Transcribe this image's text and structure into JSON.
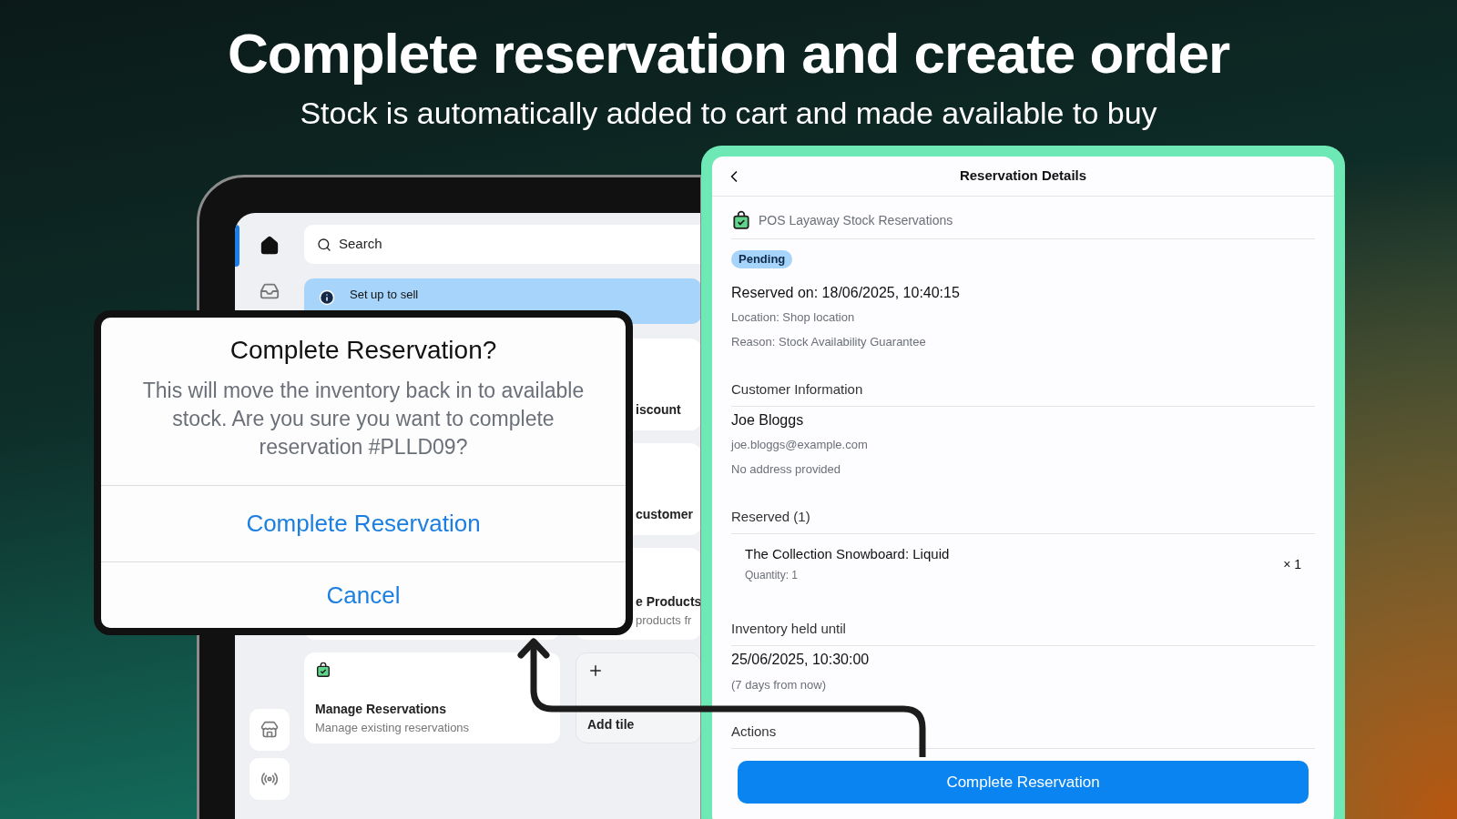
{
  "headline": {
    "title": "Complete reservation and create order",
    "subtitle": "Stock is automatically added to cart and made available to buy"
  },
  "tablet": {
    "sidebar": [
      {
        "kind": "home",
        "selected": true
      },
      {
        "kind": "inbox",
        "selected": false
      },
      {
        "kind": "store",
        "selected": false
      },
      {
        "kind": "broadcast",
        "selected": false
      }
    ],
    "search": {
      "placeholder": "Search"
    },
    "banner": {
      "title": "Set up to sell"
    },
    "tiles": [
      {
        "title": "iscount"
      },
      {
        "title": "customer"
      },
      {
        "title": "e Products",
        "subtitle": "products fr"
      }
    ],
    "bottom_tiles": [
      {
        "kind": "app",
        "title": "Manage Reservations",
        "subtitle": "Manage existing reservations"
      },
      {
        "kind": "add",
        "title": "Add tile"
      }
    ]
  },
  "dialog": {
    "title": "Complete Reservation?",
    "message": "This will move the inventory back in to available stock. Are you sure you want to complete reservation #PLLD09?",
    "actions": [
      {
        "label": "Complete Reservation"
      },
      {
        "label": "Cancel"
      }
    ]
  },
  "details": {
    "title": "Reservation Details",
    "app_name": "POS Layaway Stock Reservations",
    "status": "Pending",
    "reserved_on": "Reserved on: 18/06/2025, 10:40:15",
    "location": "Location: Shop location",
    "reason": "Reason: Stock Availability Guarantee",
    "customer": {
      "heading": "Customer Information",
      "name": "Joe Bloggs",
      "email": "joe.bloggs@example.com",
      "address": "No address provided"
    },
    "reserved": {
      "heading": "Reserved (1)",
      "items": [
        {
          "name": "The Collection Snowboard: Liquid",
          "quantity": "Quantity: 1",
          "count": "× 1"
        }
      ]
    },
    "held": {
      "heading": "Inventory held until",
      "date": "25/06/2025, 10:30:00",
      "relative": "(7 days from now)"
    },
    "actions": {
      "heading": "Actions",
      "button": "Complete Reservation"
    }
  }
}
